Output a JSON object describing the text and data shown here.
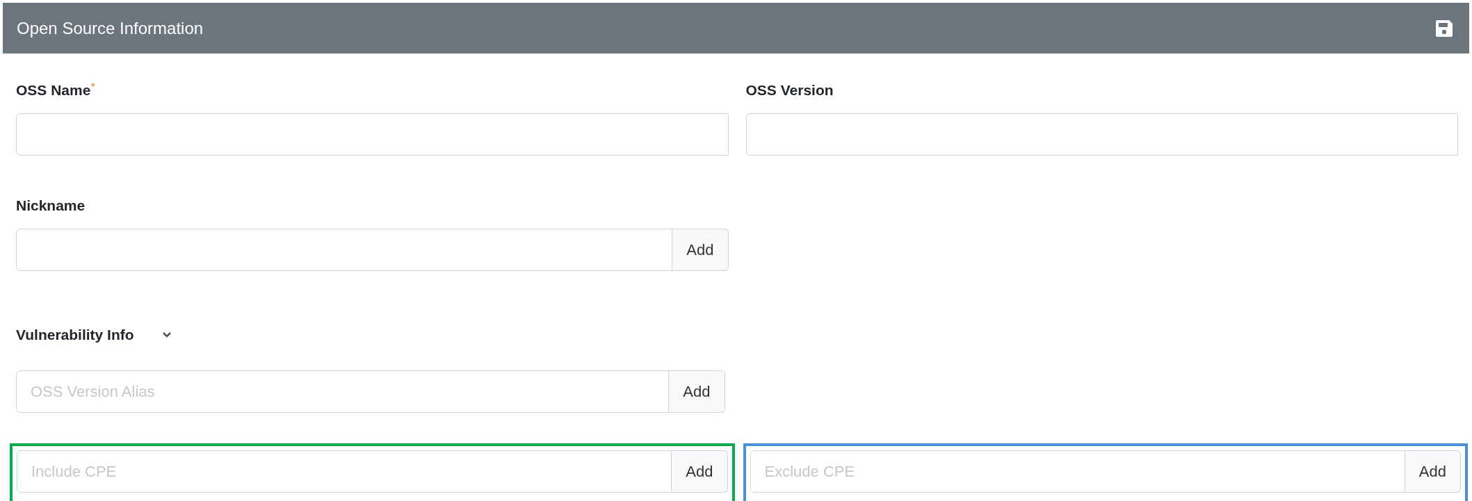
{
  "panel": {
    "title": "Open Source Information"
  },
  "oss_name": {
    "label": "OSS Name",
    "required_mark": "*"
  },
  "oss_version": {
    "label": "OSS Version"
  },
  "nickname": {
    "label": "Nickname",
    "button": "Add"
  },
  "vulnerability_info": {
    "label": "Vulnerability Info",
    "expanded": true,
    "alias": {
      "placeholder": "OSS Version Alias",
      "button": "Add"
    },
    "cpe": [
      {
        "placeholder": "Include CPE",
        "button": "Add",
        "color": "#0aab4b"
      },
      {
        "placeholder": "Exclude CPE",
        "button": "Add",
        "color": "#4a8fdb"
      }
    ]
  }
}
